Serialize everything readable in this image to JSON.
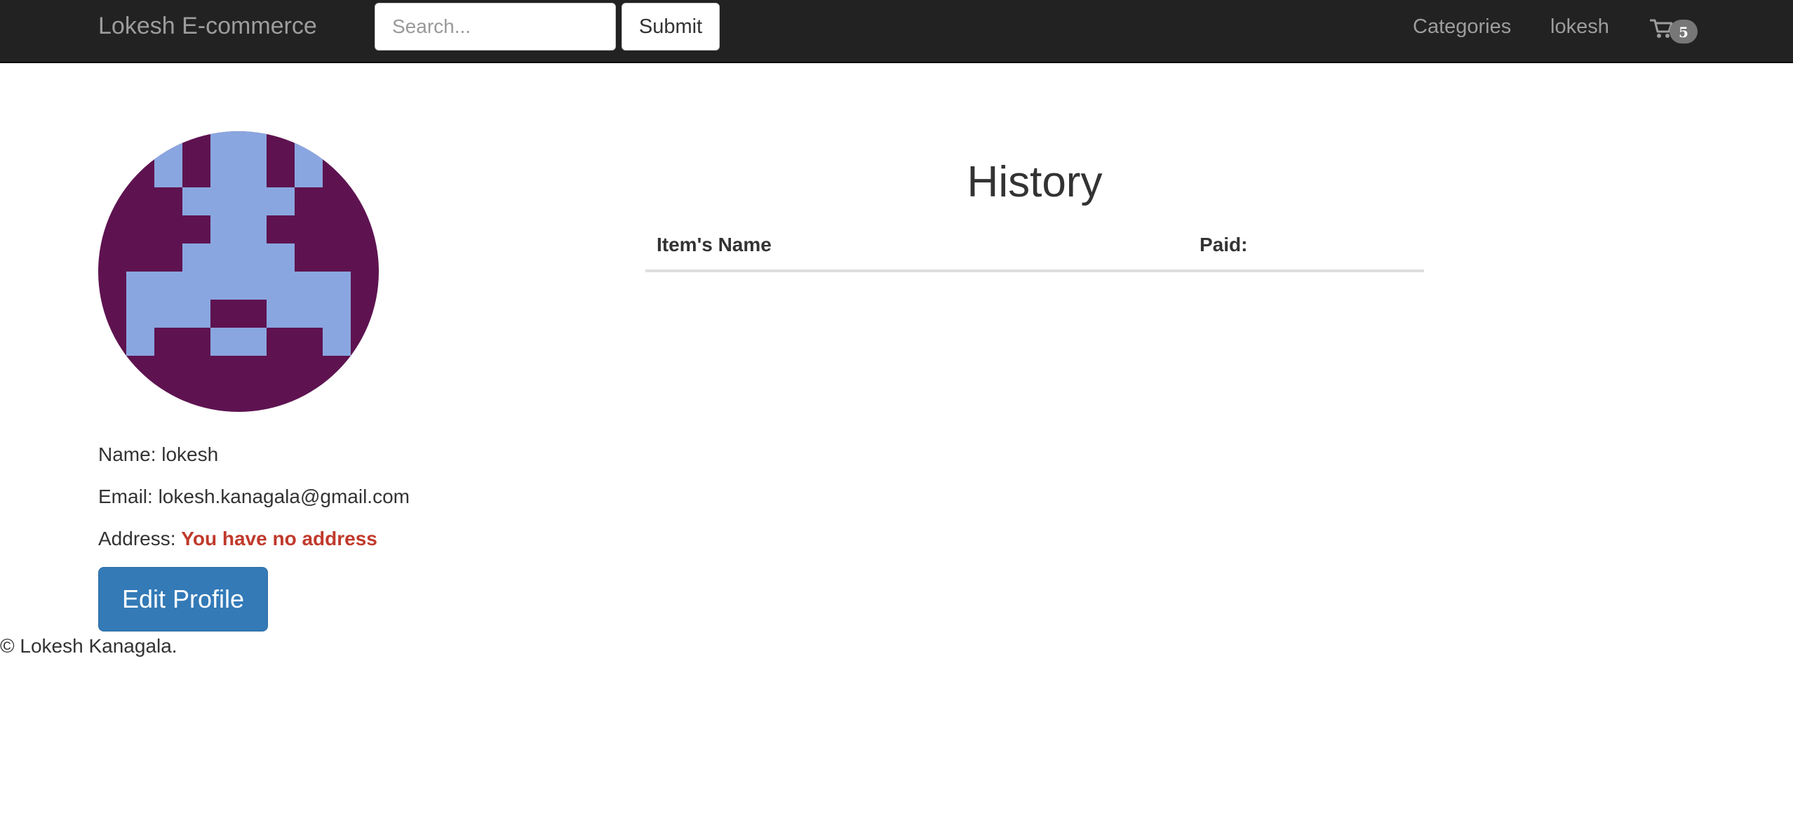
{
  "navbar": {
    "brand": "Lokesh E-commerce",
    "search_placeholder": "Search...",
    "search_value": "",
    "submit_label": "Submit",
    "categories_label": "Categories",
    "user_label": "lokesh",
    "cart_count": "5",
    "cart_icon": "shopping-cart-icon"
  },
  "profile": {
    "avatar_icon": "space-invader-identicon",
    "name_label": "Name: ",
    "name": "lokesh",
    "email_label": "Email: ",
    "email": "lokesh.kanagala@gmail.com",
    "address_label": "Address: ",
    "address": "You have no address",
    "edit_label": "Edit Profile"
  },
  "history": {
    "title": "History",
    "columns": [
      "Item's Name",
      "Paid:"
    ],
    "rows": []
  },
  "footer": {
    "text": "© Lokesh Kanagala."
  },
  "colors": {
    "navbar_bg": "#222222",
    "primary_button": "#337ab7",
    "avatar_bg": "#5e1350",
    "avatar_fg": "#8aa6e0",
    "no_address": "#c0392b"
  }
}
